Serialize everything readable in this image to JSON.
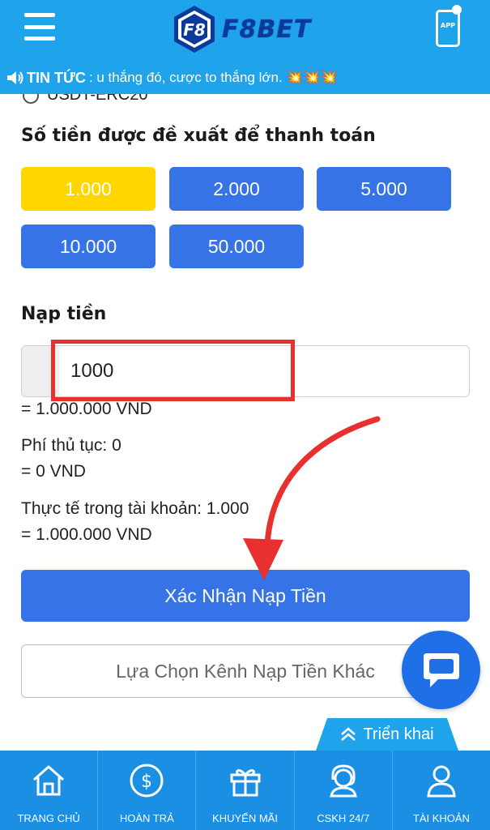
{
  "header": {
    "logo_text": "F8BET",
    "logo_badge_text": "F8",
    "app_label": "APP"
  },
  "news": {
    "label": "TIN TỨC",
    "text": ": u thắng đó, cược to thắng lớn. 💥💥💥"
  },
  "partial_option": {
    "label": "USDT-ERC20"
  },
  "suggested": {
    "title": "Số tiền được đề xuất để thanh toán",
    "amounts": [
      "1.000",
      "2.000",
      "5.000",
      "10.000",
      "50.000"
    ],
    "selected": "1.000"
  },
  "deposit": {
    "title": "Nạp tiền",
    "input_value": "1000",
    "converted": "= 1.000.000 VND",
    "fee_label": "Phí thủ tục: 0",
    "fee_converted": "= 0 VND",
    "actual_label": "Thực tế trong tài khoản: 1.000",
    "actual_converted": "= 1.000.000 VND"
  },
  "actions": {
    "confirm_label": "Xác Nhận Nạp Tiền",
    "other_channel_label": "Lựa Chọn Kênh Nạp Tiền Khác"
  },
  "expand_tab": {
    "label": "Triển khai"
  },
  "bottom_nav": {
    "items": [
      {
        "label": "TRANG CHỦ",
        "icon": "home-icon"
      },
      {
        "label": "HOÀN TRẢ",
        "icon": "dollar-coin-icon"
      },
      {
        "label": "KHUYẾN MÃI",
        "icon": "gift-icon"
      },
      {
        "label": "CSKH 24/7",
        "icon": "headset-icon"
      },
      {
        "label": "TÀI KHOẢN",
        "icon": "user-icon"
      }
    ]
  },
  "colors": {
    "header_bg": "#1fa3ea",
    "primary_button": "#3573e6",
    "selected_amount": "#ffd600",
    "annotation_red": "#e8302e",
    "nav_bg": "#1a8fe3"
  }
}
